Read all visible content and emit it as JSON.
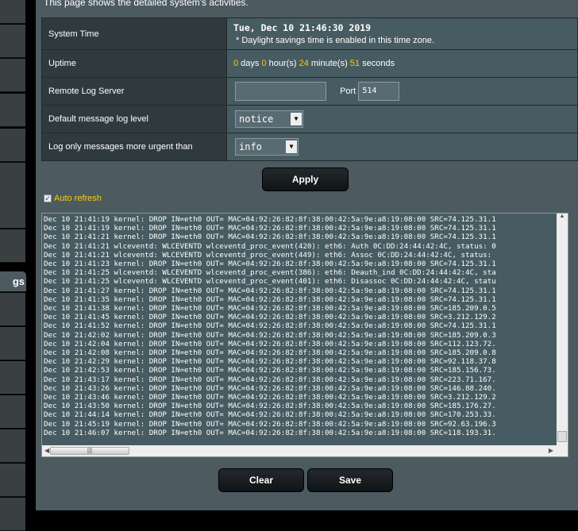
{
  "sidebar": {
    "selected_label": "gs"
  },
  "header": {
    "description": "This page shows the detailed system's activities."
  },
  "settings": {
    "system_time_label": "System Time",
    "system_time_value": "Tue, Dec 10 21:46:30 2019",
    "dst_note": "* Daylight savings time is enabled in this time zone.",
    "uptime_label": "Uptime",
    "uptime": {
      "days": "0",
      "days_unit": " days ",
      "hours": "0",
      "hours_unit": " hour(s) ",
      "minutes": "24",
      "minutes_unit": " minute(s) ",
      "seconds": "51",
      "seconds_unit": " seconds"
    },
    "remote_log_label": "Remote Log Server",
    "remote_log_value": "",
    "port_label": "Port",
    "port_value": "514",
    "default_level_label": "Default message log level",
    "default_level_value": "notice",
    "urgent_label": "Log only messages more urgent than",
    "urgent_value": "info"
  },
  "buttons": {
    "apply": "Apply",
    "clear": "Clear",
    "save": "Save"
  },
  "auto_refresh": {
    "label": "Auto refresh",
    "checked": true
  },
  "log_lines": [
    "Dec 10 21:41:19 kernel: DROP IN=eth0 OUT= MAC=04:92:26:82:8f:38:00:42:5a:9e:a8:19:08:00 SRC=74.125.31.1",
    "Dec 10 21:41:19 kernel: DROP IN=eth0 OUT= MAC=04:92:26:82:8f:38:00:42:5a:9e:a8:19:08:00 SRC=74.125.31.1",
    "Dec 10 21:41:21 kernel: DROP IN=eth0 OUT= MAC=04:92:26:82:8f:38:00:42:5a:9e:a8:19:08:00 SRC=74.125.31.1",
    "Dec 10 21:41:21 wlceventd: WLCEVENTD wlceventd_proc_event(420): eth6: Auth 0C:DD:24:44:42:4C, status: 0",
    "Dec 10 21:41:21 wlceventd: WLCEVENTD wlceventd_proc_event(449): eth6: Assoc 0C:DD:24:44:42:4C, status:",
    "Dec 10 21:41:23 kernel: DROP IN=eth0 OUT= MAC=04:92:26:82:8f:38:00:42:5a:9e:a8:19:08:00 SRC=74.125.31.1",
    "Dec 10 21:41:25 wlceventd: WLCEVENTD wlceventd_proc_event(386): eth6: Deauth_ind 0C:DD:24:44:42:4C, sta",
    "Dec 10 21:41:25 wlceventd: WLCEVENTD wlceventd_proc_event(401): eth6: Disassoc 0C:DD:24:44:42:4C, statu",
    "Dec 10 21:41:27 kernel: DROP IN=eth0 OUT= MAC=04:92:26:82:8f:38:00:42:5a:9e:a8:19:08:00 SRC=74.125.31.1",
    "Dec 10 21:41:35 kernel: DROP IN=eth0 OUT= MAC=04:92:26:82:8f:38:00:42:5a:9e:a8:19:08:00 SRC=74.125.31.1",
    "Dec 10 21:41:38 kernel: DROP IN=eth0 OUT= MAC=04:92:26:82:8f:38:00:42:5a:9e:a8:19:08:00 SRC=185.209.0.5",
    "Dec 10 21:41:45 kernel: DROP IN=eth0 OUT= MAC=04:92:26:82:8f:38:00:42:5a:9e:a8:19:08:00 SRC=3.212.129.2",
    "Dec 10 21:41:52 kernel: DROP IN=eth0 OUT= MAC=04:92:26:82:8f:38:00:42:5a:9e:a8:19:08:00 SRC=74.125.31.1",
    "Dec 10 21:42:02 kernel: DROP IN=eth0 OUT= MAC=04:92:26:82:8f:38:00:42:5a:9e:a8:19:08:00 SRC=185.209.0.3",
    "Dec 10 21:42:04 kernel: DROP IN=eth0 OUT= MAC=04:92:26:82:8f:38:00:42:5a:9e:a8:19:08:00 SRC=112.123.72.",
    "Dec 10 21:42:08 kernel: DROP IN=eth0 OUT= MAC=04:92:26:82:8f:38:00:42:5a:9e:a8:19:08:00 SRC=185.209.0.8",
    "Dec 10 21:42:29 kernel: DROP IN=eth0 OUT= MAC=04:92:26:82:8f:38:00:42:5a:9e:a8:19:08:00 SRC=92.118.37.8",
    "Dec 10 21:42:53 kernel: DROP IN=eth0 OUT= MAC=04:92:26:82:8f:38:00:42:5a:9e:a8:19:08:00 SRC=185.156.73.",
    "Dec 10 21:43:17 kernel: DROP IN=eth0 OUT= MAC=04:92:26:82:8f:38:00:42:5a:9e:a8:19:08:00 SRC=223.71.167.",
    "Dec 10 21:43:26 kernel: DROP IN=eth0 OUT= MAC=04:92:26:82:8f:38:00:42:5a:9e:a8:19:08:00 SRC=146.88.240.",
    "Dec 10 21:43:46 kernel: DROP IN=eth0 OUT= MAC=04:92:26:82:8f:38:00:42:5a:9e:a8:19:08:00 SRC=3.212.129.2",
    "Dec 10 21:43:50 kernel: DROP IN=eth0 OUT= MAC=04:92:26:82:8f:38:00:42:5a:9e:a8:19:08:00 SRC=185.176.27.",
    "Dec 10 21:44:14 kernel: DROP IN=eth0 OUT= MAC=04:92:26:82:8f:38:00:42:5a:9e:a8:19:08:00 SRC=170.253.33.",
    "Dec 10 21:45:19 kernel: DROP IN=eth0 OUT= MAC=04:92:26:82:8f:38:00:42:5a:9e:a8:19:08:00 SRC=92.63.196.3",
    "Dec 10 21:46:07 kernel: DROP IN=eth0 OUT= MAC=04:92:26:82:8f:38:00:42:5a:9e:a8:19:08:00 SRC=118.193.31."
  ],
  "colors": {
    "accent": "#ffcc00",
    "panel": "#4d5a60"
  }
}
